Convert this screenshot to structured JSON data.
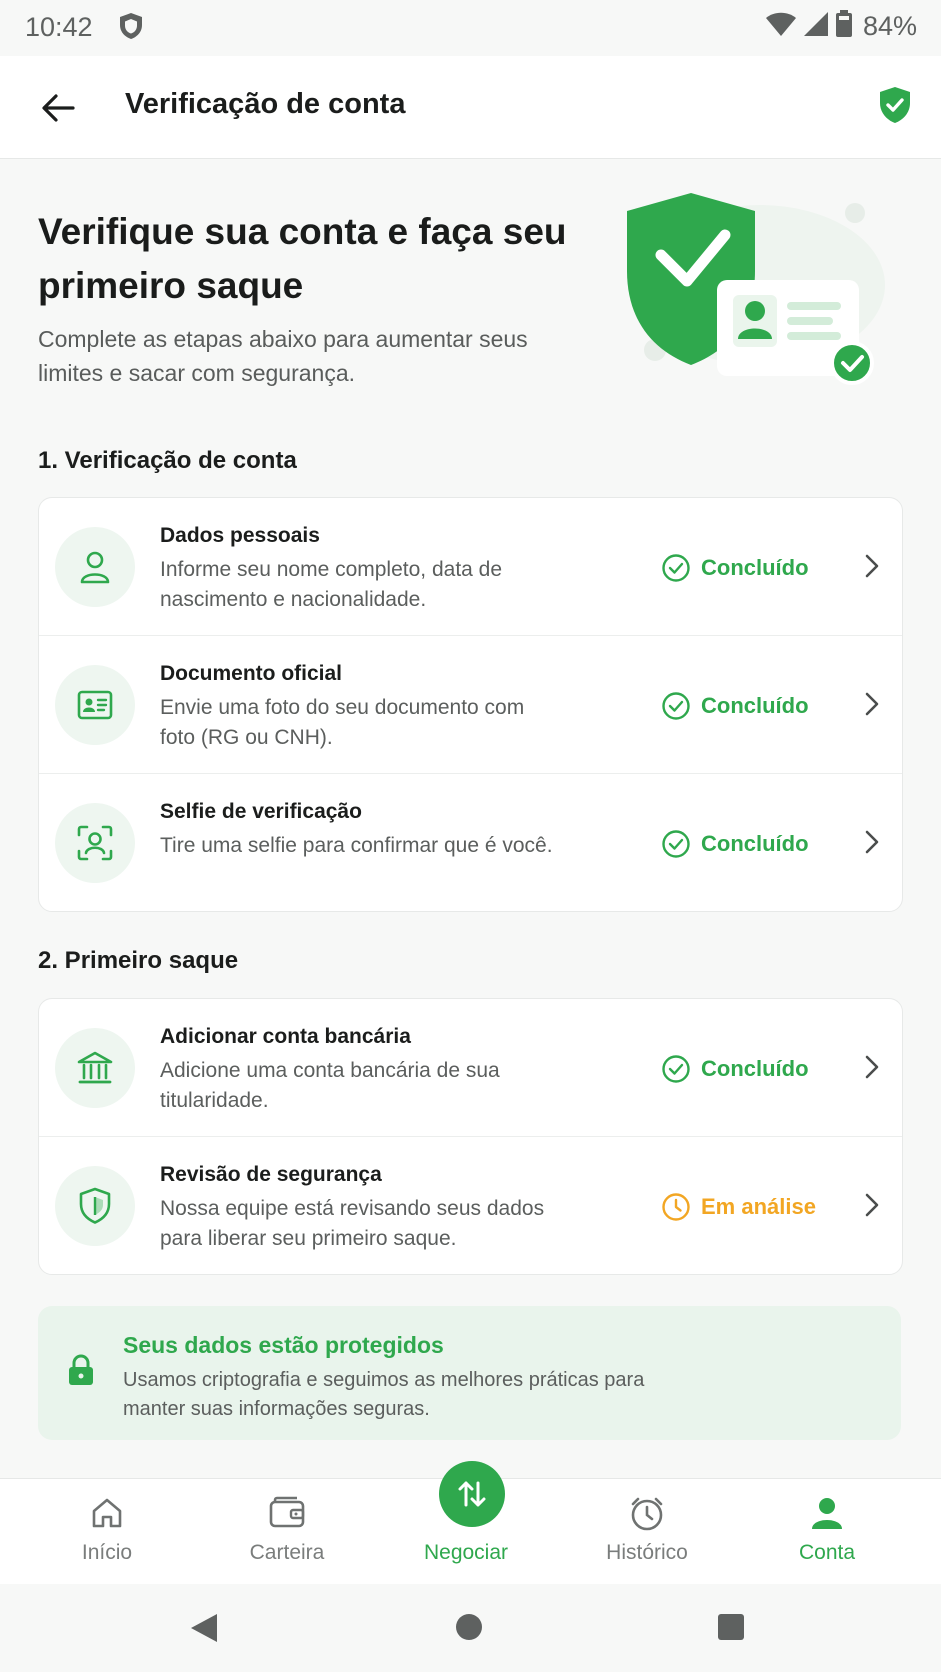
{
  "status_bar": {
    "time": "10:42",
    "battery": "84%"
  },
  "app_bar": {
    "title": "Verificação de conta"
  },
  "hero": {
    "title": "Verifique sua conta e faça seu primeiro saque",
    "subtitle": "Complete as etapas abaixo para aumentar seus limites e sacar com segurança."
  },
  "section1": {
    "title": "1. Verificação de conta",
    "steps": [
      {
        "icon": "person-icon",
        "title": "Dados pessoais",
        "description": "Informe seu nome completo, data de nascimento e nacionalidade.",
        "status": "Concluído"
      },
      {
        "icon": "id-card-icon",
        "title": "Documento oficial",
        "description": "Envie uma foto do seu documento com foto (RG ou CNH).",
        "status": "Concluído"
      },
      {
        "icon": "face-scan-icon",
        "title": "Selfie de verificação",
        "description": "Tire uma selfie para confirmar que é você.",
        "status": "Concluído"
      }
    ]
  },
  "section2": {
    "title": "2. Primeiro saque",
    "steps": [
      {
        "icon": "bank-icon",
        "title": "Adicionar conta bancária",
        "description": "Adicione uma conta bancária de sua titularidade.",
        "status": "Concluído"
      },
      {
        "icon": "shield-icon",
        "title": "Revisão de segurança",
        "description": "Nossa equipe está revisando seus dados para liberar seu primeiro saque.",
        "status": "Em análise"
      }
    ]
  },
  "protection": {
    "title": "Seus dados estão protegidos",
    "description": "Usamos criptografia e seguimos as melhores práticas para manter suas informações seguras."
  },
  "bottom_nav": {
    "items": [
      {
        "label": "Início",
        "icon": "home-icon"
      },
      {
        "label": "Carteira",
        "icon": "wallet-icon"
      },
      {
        "label": "Negociar",
        "icon": "swap-icon"
      },
      {
        "label": "Histórico",
        "icon": "clock-icon"
      },
      {
        "label": "Conta",
        "icon": "person-icon"
      }
    ],
    "active": "Conta"
  },
  "colors": {
    "primary": "#2fa84d",
    "pending": "#f2a623",
    "text": "#1b1d1c",
    "muted": "#5b5e5d"
  }
}
